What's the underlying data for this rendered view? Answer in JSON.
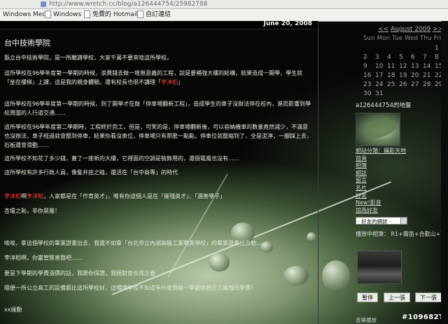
{
  "browser": {
    "url": "http://www.wretch.cc/blog/a126444754/25982788",
    "bookmarks": [
      "Windows Media",
      "Windows",
      "免費的 Hotmail",
      "自訂連結"
    ]
  },
  "post": {
    "date": "June 20, 2008",
    "title": "台中技術學院",
    "paragraphs": {
      "p1": "翫立台中技術學院，是一所離譜學校，大家千萬不要來唸這所學校。",
      "p2": "這所學校在96學年度第一學期的時候，浪費錢去做一堆無意義的工程，說是要補強大樓的結構，結果造成一開學，學生就「坐在樓梯」上課，這是我的親身體驗。還有校長也很不講理",
      "p2_name": "李淳稻",
      "p3": "這所學校在96學年度第一學期的時候，到了開學才在做「停車場翻新工程」，造成學生的車子沒辦法停在校內，進而影響到學校周圍的人行道交通……",
      "p4": "這所學校在96學年度第二學期時，工程終於完工，但是，可笑的是，停車場翻新後，可以容納機車的數量竟然減少，不滿意也沒辦法，車子經過就會壓到停車，結果你看沒車位，停車場只有那麼一點點，停車位就壓縮到了，全是泥濘，一腳踩上去，石板還會滑動……",
      "p5": "這所學校不知花了多少錢，蓋了一座新的大樓，它裡面的空調是裝飾用的，還個電風也沒有……",
      "p6": "這所學校有許多行政人員，像隻井底之蛙，還活在「台中商專」的時代",
      "p7_name": "李淳稻",
      "p7_mid": "啊",
      "p7_name2": "李淳稻",
      "p7": "，人家都是在「作育英才」，唯有你這個人是在「摧殘英才」、「溷害學子」",
      "p8": "杏壇之恥，非你莫屬！",
      "p9": "唉唉，拿這個學校的畢業證書出去，我還不如拿「台北市立內湖高級工業職業學校」的畢業證書出去勒……",
      "p10": "李淳稻啊，你叢管獎害我吧……",
      "p11": "要是下學期的學費漲價的話，我跟你保證，我絕對會去找立委",
      "p12": "隨便一所公立高工的設備都比這所學校好，這種爛學校不知道有什麼資格一學期收將近三萬塊的學費？",
      "p13": "xx緣動"
    }
  },
  "sidebar": {
    "calendar": {
      "prev": "<<",
      "month": "August 2009",
      "next": ">>",
      "days_header": "Sun Mon Tue Wed Thu Fri Sat",
      "rows": [
        [
          "",
          "",
          "",
          "",
          "",
          "",
          "1"
        ],
        [
          "2",
          "3",
          "4",
          "5",
          "6",
          "7",
          "8"
        ],
        [
          "9",
          "10",
          "11",
          "12",
          "13",
          "14",
          "15"
        ],
        [
          "16",
          "17",
          "18",
          "19",
          "20",
          "21",
          "22"
        ],
        [
          "23",
          "24",
          "25",
          "26",
          "27",
          "28",
          "29"
        ],
        [
          "30",
          "31",
          "",
          "",
          "",
          "",
          ""
        ]
      ]
    },
    "profile_heading": "a126444754的地盤",
    "links": [
      "網站分類：攝影天地",
      "首頁",
      "相簿",
      "網誌",
      "留言",
      "名片",
      "好友",
      "New!影音",
      "加為好友"
    ],
    "friends_select": "- 好友的網誌 -",
    "playing_label": "播放中相簿： R1+霧笛+合歡山+雨",
    "buttons": [
      "暫停",
      "上一張",
      "下一張"
    ],
    "music_label": "音樂播放",
    "counter": "#109682T"
  }
}
